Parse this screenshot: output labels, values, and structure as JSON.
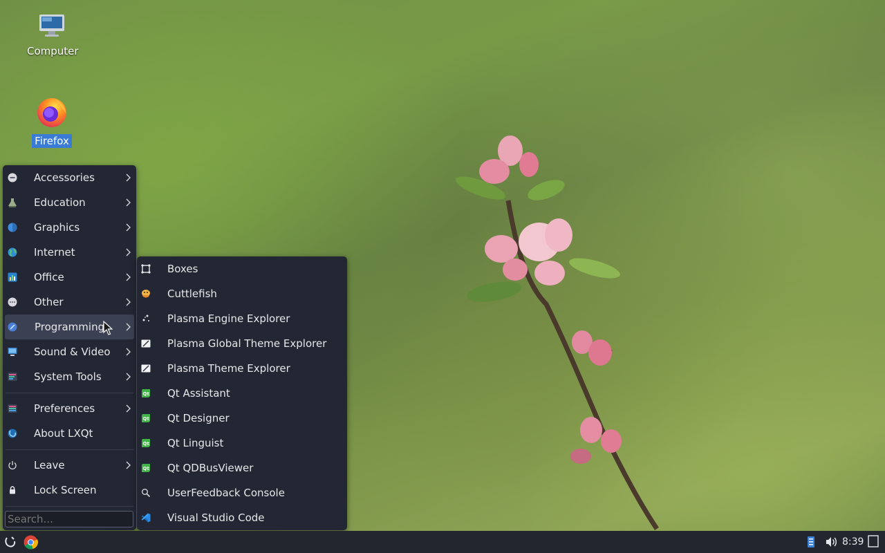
{
  "desktop": {
    "icons": [
      {
        "label": "Computer",
        "icon": "computer-icon"
      },
      {
        "label": "Firefox",
        "icon": "firefox-icon",
        "selected": true
      }
    ]
  },
  "main_menu": {
    "items": [
      {
        "label": "Accessories",
        "icon": "accessories-icon",
        "submenu": true
      },
      {
        "label": "Education",
        "icon": "education-icon",
        "submenu": true
      },
      {
        "label": "Graphics",
        "icon": "graphics-icon",
        "submenu": true
      },
      {
        "label": "Internet",
        "icon": "internet-icon",
        "submenu": true
      },
      {
        "label": "Office",
        "icon": "office-icon",
        "submenu": true
      },
      {
        "label": "Other",
        "icon": "other-icon",
        "submenu": true
      },
      {
        "label": "Programming",
        "icon": "programming-icon",
        "submenu": true,
        "highlighted": true
      },
      {
        "label": "Sound & Video",
        "icon": "sound-video-icon",
        "submenu": true
      },
      {
        "label": "System Tools",
        "icon": "system-tools-icon",
        "submenu": true
      },
      {
        "label": "Preferences",
        "icon": "preferences-icon",
        "submenu": true
      },
      {
        "label": "About LXQt",
        "icon": "lxqt-icon",
        "submenu": false
      },
      {
        "label": "Leave",
        "icon": "power-icon",
        "submenu": true
      },
      {
        "label": "Lock Screen",
        "icon": "lock-icon",
        "submenu": false
      }
    ],
    "search_placeholder": "Search..."
  },
  "programming_submenu": {
    "items": [
      {
        "label": "Boxes",
        "icon": "boxes-icon"
      },
      {
        "label": "Cuttlefish",
        "icon": "cuttlefish-icon"
      },
      {
        "label": "Plasma Engine Explorer",
        "icon": "plasma-engine-icon"
      },
      {
        "label": "Plasma Global Theme Explorer",
        "icon": "plasma-theme-icon"
      },
      {
        "label": "Plasma Theme Explorer",
        "icon": "plasma-theme-icon"
      },
      {
        "label": "Qt Assistant",
        "icon": "qt-icon"
      },
      {
        "label": "Qt Designer",
        "icon": "qt-icon"
      },
      {
        "label": "Qt Linguist",
        "icon": "qt-icon"
      },
      {
        "label": "Qt QDBusViewer",
        "icon": "qt-icon"
      },
      {
        "label": "UserFeedback Console",
        "icon": "search-icon"
      },
      {
        "label": "Visual Studio Code",
        "icon": "vscode-icon"
      }
    ]
  },
  "taskbar": {
    "clock": "8:39",
    "tray_icons": [
      "keyboard-layout-icon",
      "volume-icon",
      "show-desktop-icon"
    ],
    "launchers": [
      "lxqt-menu-icon",
      "chrome-icon"
    ]
  },
  "colors": {
    "menu_bg": "#232733",
    "highlight": "#3b4152",
    "selection": "#3a7bd5",
    "taskbar": "#22262f"
  }
}
